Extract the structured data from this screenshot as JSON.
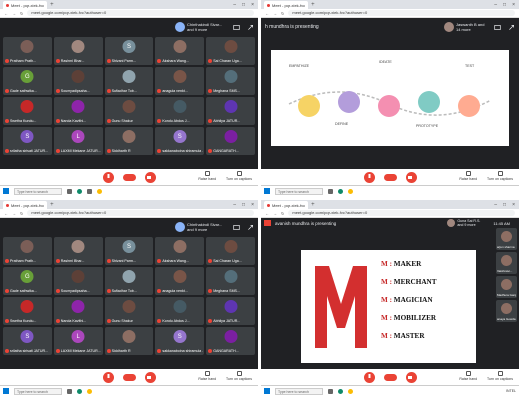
{
  "browser": {
    "tab_title": "Meet - pqr-xiek-fvc",
    "url": "meet.google.com/pqr-xiek-fvc?authuser=0",
    "url_q4": "meet.google.com/pqr-xiek-fvc?authuser=0"
  },
  "q1": {
    "presenter_chip": "Chinthakindi Sivar... and 9 more",
    "tiles": [
      {
        "name": "Pratham Prath...",
        "initial": "",
        "color": "#7b5e57"
      },
      {
        "name": "Rashmi Bhar...",
        "initial": "",
        "color": "#a1887f"
      },
      {
        "name": "Shivani Parm...",
        "initial": "S",
        "color": "#78909c"
      },
      {
        "name": "Akshara Wang...",
        "initial": "",
        "color": "#8d6e63"
      },
      {
        "name": "Sai Charan Uga...",
        "initial": "",
        "color": "#6d4c41"
      },
      {
        "name": "Gade sathwika...",
        "initial": "G",
        "color": "#689f38"
      },
      {
        "name": "Soumyadipsaha...",
        "initial": "",
        "color": "#5d4037"
      },
      {
        "name": "Sufiadhar Tob...",
        "initial": "",
        "color": "#90a4ae"
      },
      {
        "name": "anagula venkt...",
        "initial": "",
        "color": "#795548"
      },
      {
        "name": "Meghana SMS...",
        "initial": "",
        "color": "#546e7a"
      },
      {
        "name": "Swetha Kundu...",
        "initial": "",
        "color": "#c62828"
      },
      {
        "name": "Nanda Kavithi...",
        "initial": "",
        "color": "#8e24aa"
      },
      {
        "name": "Gunu Shakur",
        "initial": "",
        "color": "#6d4c41"
      },
      {
        "name": "Kondu Abdus J...",
        "initial": "",
        "color": "#455a64"
      },
      {
        "name": "Abhilya JATUR...",
        "initial": "",
        "color": "#5e35b1"
      },
      {
        "name": "srilatha sirisati JATUR...",
        "initial": "S",
        "color": "#7e57c2"
      },
      {
        "name": "LAXMI Mekane JATUR...",
        "initial": "L",
        "color": "#ab47bc"
      },
      {
        "name": "Siddharth R",
        "initial": "",
        "color": "#8d6e63"
      },
      {
        "name": "sakkanaboina shiramula ...",
        "initial": "S",
        "color": "#9575cd"
      },
      {
        "name": "GANGARATH...",
        "initial": "",
        "color": "#7b1fa2"
      }
    ]
  },
  "q2": {
    "presenting": "h mundhra is presenting",
    "presenter_chip": "Jaswanth B and 14 more",
    "steps": [
      "EMPATHIZE",
      "DEFINE",
      "IDEATE",
      "PROTOTYPE",
      "TEST"
    ]
  },
  "q4": {
    "presenting": "avanish mundhra is presenting",
    "presenter_chip": "Guna Sai R.S. and 9 more",
    "clock": "11:45 AM",
    "m_items": [
      "MAKER",
      "MERCHANT",
      "MAGICIAN",
      "MOBILIZER",
      "MASTER"
    ],
    "m_prefix": "M :",
    "rail": [
      "arjun sharma",
      "Vaishnavi...",
      "Madhura Ganj...",
      "anaya Gowda"
    ]
  },
  "controls": {
    "raise_hand": "Raise hand",
    "captions": "Turn on captions"
  },
  "taskbar": {
    "search": "Type here to search",
    "clock": "INTEL"
  },
  "colors": {
    "red": "#ea4335",
    "meet_bg": "#202124",
    "tile": "#3c4043"
  }
}
